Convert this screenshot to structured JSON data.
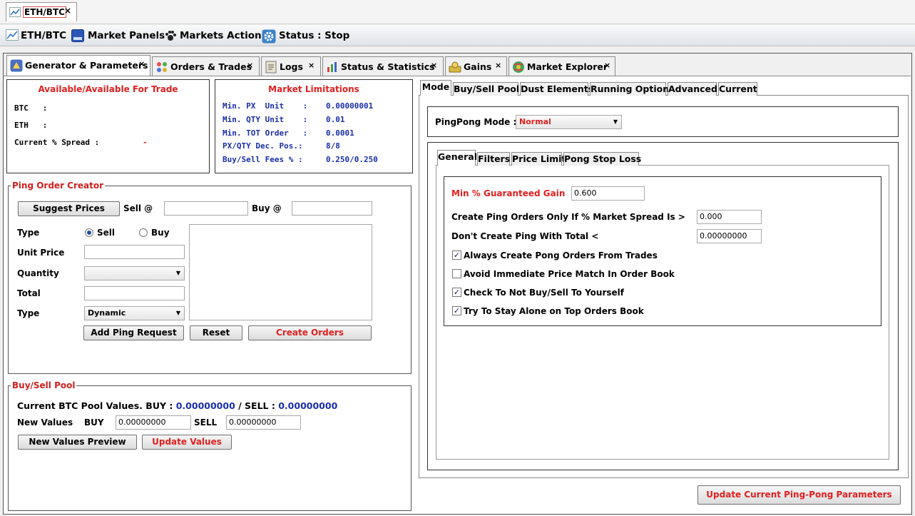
{
  "window_tab": {
    "label": "ETH/BTC",
    "close": "×"
  },
  "toolbar": {
    "pair": "ETH/BTC",
    "market_panels": "Market Panels",
    "markets_actions": "Markets Actions",
    "status": "Status : Stop"
  },
  "main_tabs": [
    {
      "label": "Generator & Parameters",
      "icon": "generator-icon",
      "close": "×"
    },
    {
      "label": "Orders & Trades",
      "icon": "orders-icon",
      "close": "×"
    },
    {
      "label": "Logs",
      "icon": "log-icon",
      "close": "×"
    },
    {
      "label": "Status & Statistics",
      "icon": "chart-icon",
      "close": "×"
    },
    {
      "label": "Gains",
      "icon": "money-icon",
      "close": "×"
    },
    {
      "label": "Market Explorer",
      "icon": "globe-icon",
      "close": "×"
    }
  ],
  "available": {
    "title": "Available/Available For Trade",
    "btc_label": "BTC   :",
    "eth_label": "ETH   :",
    "spread_label": "Current % Spread :",
    "spread_value": "-"
  },
  "limitations": {
    "title": "Market Limitations",
    "rows": [
      {
        "label": "Min. PX  Unit    :",
        "value": "0.00000001"
      },
      {
        "label": "Min. QTY Unit    :",
        "value": "0.01"
      },
      {
        "label": "Min. TOT Order   :",
        "value": "0.0001"
      },
      {
        "label": "PX/QTY Dec. Pos.:",
        "value": "8/8"
      },
      {
        "label": "Buy/Sell Fees % :",
        "value": "0.250/0.250"
      }
    ]
  },
  "ping_creator": {
    "title": "Ping Order Creator",
    "suggest_prices": "Suggest Prices",
    "sell_at": "Sell @",
    "buy_at": "Buy @",
    "sell_at_value": "",
    "buy_at_value": "",
    "type_label": "Type",
    "sell_radio": "Sell",
    "buy_radio": "Buy",
    "unit_price": "Unit Price",
    "unit_price_value": "",
    "quantity": "Quantity",
    "quantity_value": "",
    "total": "Total",
    "total_value": "",
    "type2_label": "Type",
    "type2_value": "Dynamic",
    "add_ping": "Add Ping Request",
    "reset": "Reset",
    "create_orders": "Create Orders"
  },
  "pool": {
    "title": "Buy/Sell Pool",
    "current_prefix": "Current BTC Pool Values. BUY :",
    "buy_value": "0.00000000",
    "sep": "/ SELL :",
    "sell_value": "0.00000000",
    "new_values": "New Values",
    "buy_label": "BUY",
    "buy_input": "0.00000000",
    "sell_label": "SELL",
    "sell_input": "0.00000000",
    "preview": "New Values Preview",
    "update": "Update Values"
  },
  "right_tabs": [
    "Mode",
    "Buy/Sell Pool",
    "Dust Elements",
    "Running Option",
    "Advanced",
    "Current"
  ],
  "mode": {
    "label": "PingPong Mode :",
    "value": "Normal"
  },
  "sub_tabs": [
    "General",
    "Filters",
    "Price Limit",
    "Pong Stop Loss"
  ],
  "general": {
    "min_gain_label": "Min % Guaranteed Gain",
    "min_gain_value": "0.600",
    "spread_label": "Create Ping Orders Only If % Market Spread Is >",
    "spread_value": "0.000",
    "total_label": "Don't Create Ping With Total <",
    "total_value": "0.00000000",
    "checks": [
      {
        "label": "Always Create Pong Orders From Trades",
        "checked": true
      },
      {
        "label": "Avoid Immediate Price Match In Order Book",
        "checked": false
      },
      {
        "label": "Check To Not Buy/Sell To Yourself",
        "checked": true
      },
      {
        "label": "Try To Stay Alone on Top Orders Book",
        "checked": true
      }
    ]
  },
  "update_params": "Update Current Ping-Pong Parameters",
  "colors": {
    "accent_red": "#e02020",
    "value_blue": "#1a2fa8"
  }
}
